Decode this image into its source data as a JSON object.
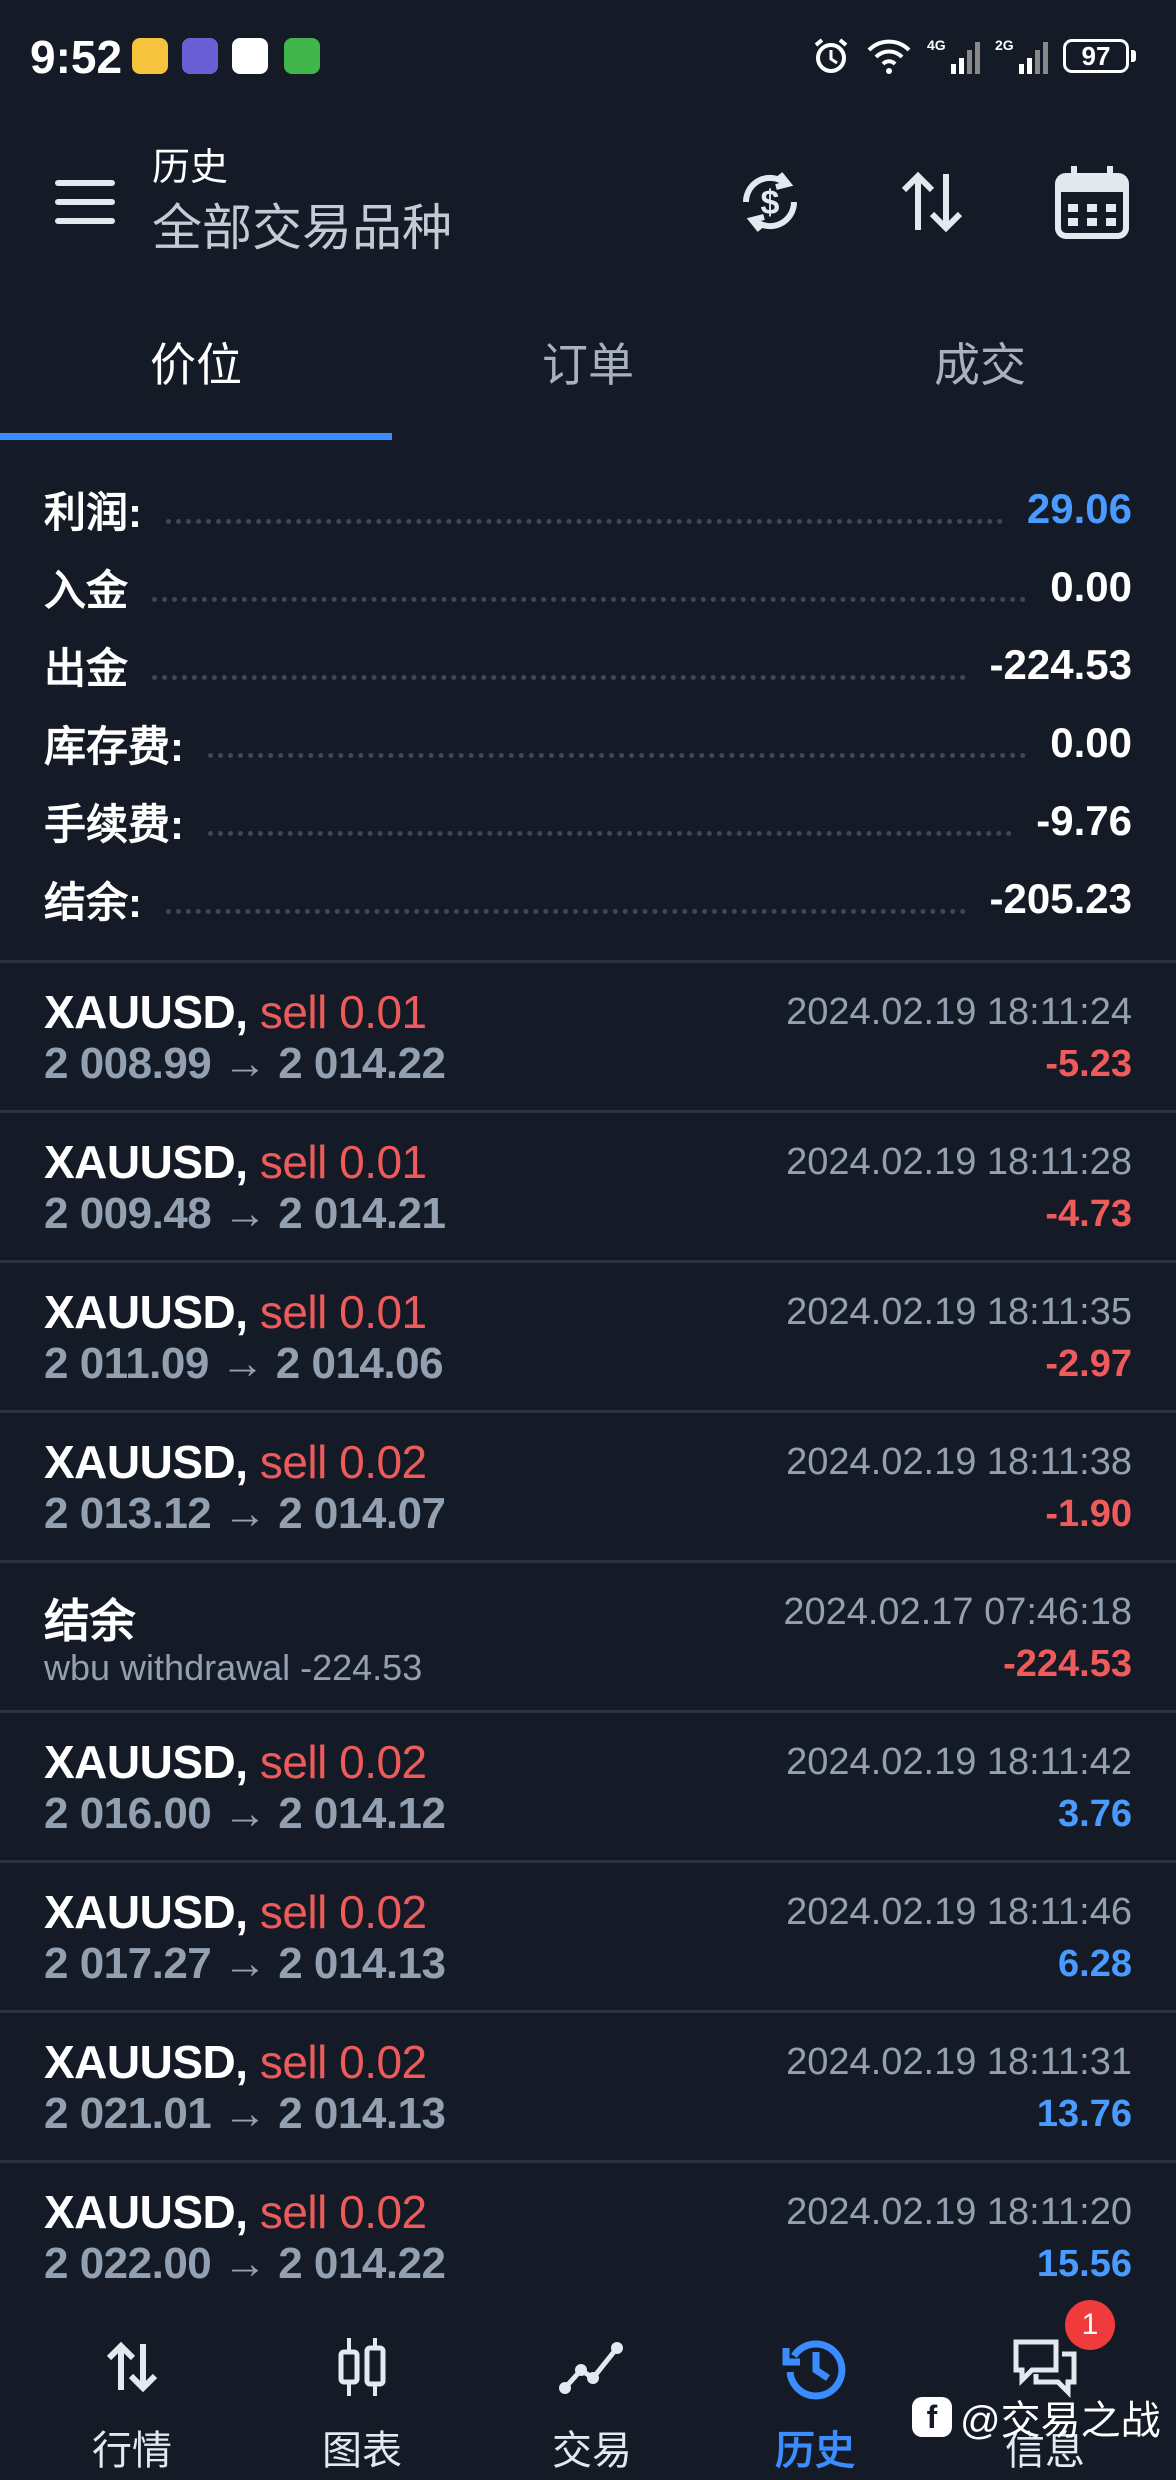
{
  "status_bar": {
    "time": "9:52",
    "battery": "97",
    "network_1": "4G",
    "network_2": "2G"
  },
  "header": {
    "title": "历史",
    "subtitle": "全部交易品种",
    "icons": [
      "currency-sync-icon",
      "sort-icon",
      "calendar-icon"
    ]
  },
  "tabs": [
    {
      "label": "价位",
      "active": true
    },
    {
      "label": "订单",
      "active": false
    },
    {
      "label": "成交",
      "active": false
    }
  ],
  "summary": [
    {
      "label": "利润:",
      "value": "29.06",
      "highlight": true
    },
    {
      "label": "入金",
      "value": "0.00"
    },
    {
      "label": "出金",
      "value": "-224.53"
    },
    {
      "label": "库存费:",
      "value": "0.00"
    },
    {
      "label": "手续费:",
      "value": "-9.76"
    },
    {
      "label": "结余:",
      "value": "-205.23"
    }
  ],
  "deals": [
    {
      "symbol": "XAUUSD,",
      "side": "sell 0.01",
      "prices": "2 008.99 → 2 014.22",
      "time": "2024.02.19 18:11:24",
      "profit": "-5.23"
    },
    {
      "symbol": "XAUUSD,",
      "side": "sell 0.01",
      "prices": "2 009.48 → 2 014.21",
      "time": "2024.02.19 18:11:28",
      "profit": "-4.73"
    },
    {
      "symbol": "XAUUSD,",
      "side": "sell 0.01",
      "prices": "2 011.09 → 2 014.06",
      "time": "2024.02.19 18:11:35",
      "profit": "-2.97"
    },
    {
      "symbol": "XAUUSD,",
      "side": "sell 0.02",
      "prices": "2 013.12 → 2 014.07",
      "time": "2024.02.19 18:11:38",
      "profit": "-1.90"
    },
    {
      "symbol": "结余",
      "side": "",
      "comment": "wbu withdrawal -224.53",
      "time": "2024.02.17 07:46:18",
      "profit": "-224.53"
    },
    {
      "symbol": "XAUUSD,",
      "side": "sell 0.02",
      "prices": "2 016.00 → 2 014.12",
      "time": "2024.02.19 18:11:42",
      "profit": "3.76"
    },
    {
      "symbol": "XAUUSD,",
      "side": "sell 0.02",
      "prices": "2 017.27 → 2 014.13",
      "time": "2024.02.19 18:11:46",
      "profit": "6.28"
    },
    {
      "symbol": "XAUUSD,",
      "side": "sell 0.02",
      "prices": "2 021.01 → 2 014.13",
      "time": "2024.02.19 18:11:31",
      "profit": "13.76"
    },
    {
      "symbol": "XAUUSD,",
      "side": "sell 0.02",
      "prices": "2 022.00 → 2 014.22",
      "time": "2024.02.19 18:11:20",
      "profit": "15.56"
    }
  ],
  "bottom_nav": [
    {
      "label": "行情",
      "icon": "quotes-arrows-icon",
      "active": false
    },
    {
      "label": "图表",
      "icon": "candlestick-icon",
      "active": false
    },
    {
      "label": "交易",
      "icon": "trade-line-icon",
      "active": false
    },
    {
      "label": "历史",
      "icon": "history-clock-icon",
      "active": true
    },
    {
      "label": "信息",
      "icon": "messages-icon",
      "active": false,
      "badge": "1"
    }
  ],
  "watermark": "@交易之战",
  "colors": {
    "background": "#141b26",
    "accent": "#3b8cff",
    "loss": "#ef5b5b",
    "profit": "#4a9bff",
    "muted": "#93a0b2"
  }
}
